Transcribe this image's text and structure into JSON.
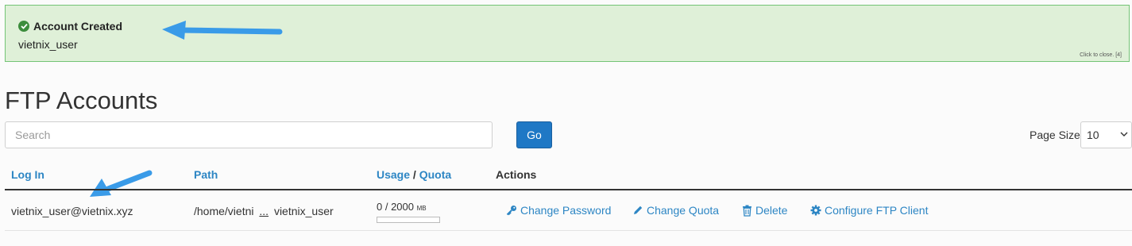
{
  "alert": {
    "title": "Account Created",
    "message": "vietnix_user",
    "close_text": "Click to close. [4]",
    "color": "#dff0d8"
  },
  "page": {
    "title": "FTP Accounts"
  },
  "search": {
    "placeholder": "Search",
    "go_label": "Go"
  },
  "page_size": {
    "label": "Page Size",
    "value": "10"
  },
  "table": {
    "headers": {
      "login": "Log In",
      "path": "Path",
      "usage": "Usage",
      "separator": "/",
      "quota": "Quota",
      "actions": "Actions"
    },
    "rows": [
      {
        "login": "vietnix_user@vietnix.xyz",
        "path_start": "/home/vietni",
        "path_ellipsis": "...",
        "path_end": "vietnix_user",
        "usage": "0 / 2000",
        "usage_unit": "MB",
        "usage_fraction": 0
      }
    ],
    "actions": {
      "change_password": "Change Password",
      "change_quota": "Change Quota",
      "delete": "Delete",
      "configure": "Configure FTP Client"
    }
  },
  "icons": [
    "check-circle-icon",
    "key-icon",
    "pencil-icon",
    "trash-icon",
    "gear-icon",
    "chevron-down-icon",
    "arrow-annotation-icon"
  ],
  "colors": {
    "link": "#2d86c4",
    "button": "#1f78c5",
    "annotation_arrow": "#3a9be8"
  }
}
